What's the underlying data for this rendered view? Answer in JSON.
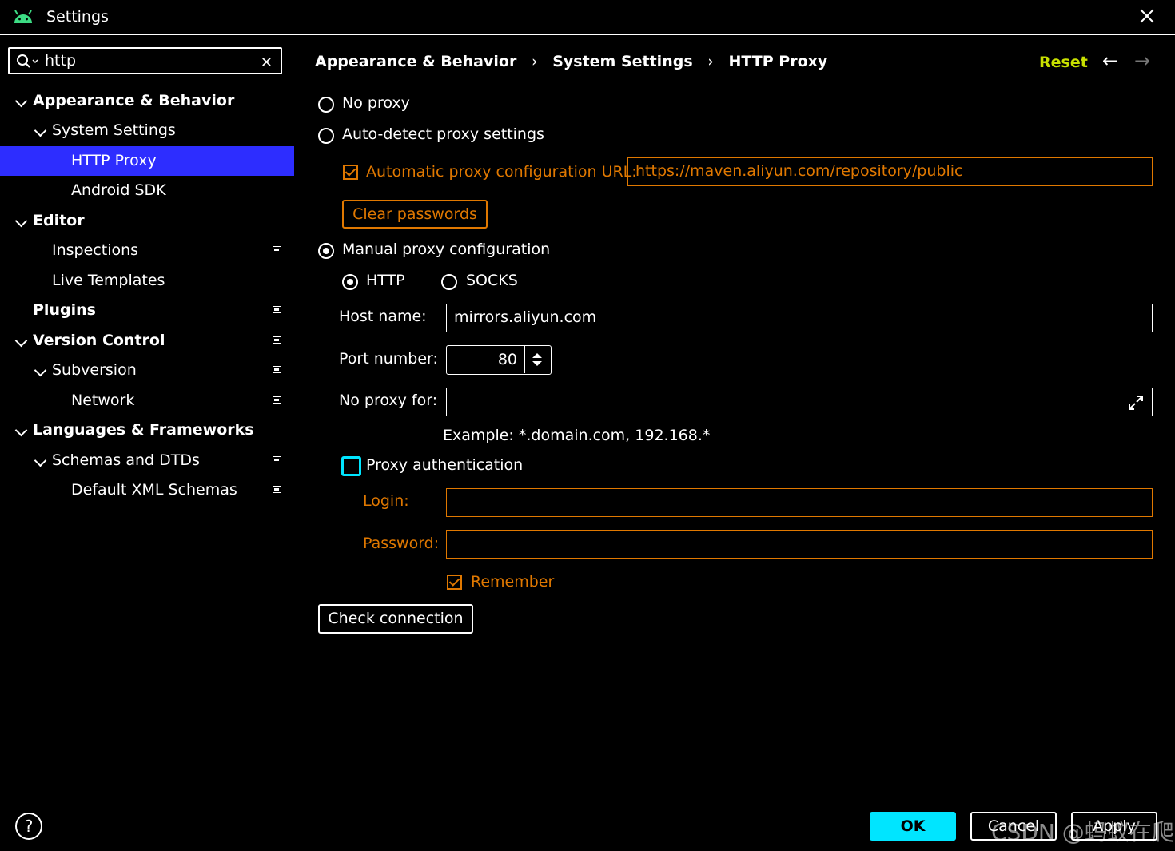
{
  "window": {
    "title": "Settings"
  },
  "search": {
    "value": "http"
  },
  "sidebar": {
    "items": [
      {
        "label": "Appearance & Behavior",
        "bold": true
      },
      {
        "label": "System Settings",
        "bold": false
      },
      {
        "label": "HTTP Proxy",
        "bold": false,
        "selected": true
      },
      {
        "label": "Android SDK",
        "bold": false
      },
      {
        "label": "Editor",
        "bold": true
      },
      {
        "label": "Inspections",
        "bold": false
      },
      {
        "label": "Live Templates",
        "bold": false
      },
      {
        "label": "Plugins",
        "bold": true
      },
      {
        "label": "Version Control",
        "bold": true
      },
      {
        "label": "Subversion",
        "bold": false
      },
      {
        "label": "Network",
        "bold": false
      },
      {
        "label": "Languages & Frameworks",
        "bold": true
      },
      {
        "label": "Schemas and DTDs",
        "bold": false
      },
      {
        "label": "Default XML Schemas",
        "bold": false
      }
    ]
  },
  "breadcrumb": {
    "items": [
      "Appearance & Behavior",
      "System Settings",
      "HTTP Proxy"
    ],
    "separator": "›"
  },
  "header": {
    "reset_label": "Reset",
    "back_icon": "←",
    "forward_icon": "→"
  },
  "proxy": {
    "no_proxy_label": "No proxy",
    "auto_detect_label": "Auto-detect proxy settings",
    "auto_url_label": "Automatic proxy configuration URL:",
    "auto_url_value": "https://maven.aliyun.com/repository/public",
    "clear_passwords_label": "Clear passwords",
    "manual_label": "Manual proxy configuration",
    "http_label": "HTTP",
    "socks_label": "SOCKS",
    "host_label": "Host name:",
    "host_value": "mirrors.aliyun.com",
    "port_label": "Port number:",
    "port_value": "80",
    "no_proxy_for_label": "No proxy for:",
    "no_proxy_for_value": "",
    "example_text": "Example: *.domain.com, 192.168.*",
    "auth_label": "Proxy authentication",
    "login_label": "Login:",
    "login_value": "",
    "password_label": "Password:",
    "password_value": "",
    "remember_label": "Remember",
    "check_connection_label": "Check connection"
  },
  "footer": {
    "help_label": "?",
    "ok_label": "OK",
    "cancel_label": "Cancel",
    "apply_label": "Apply",
    "watermark": "CSDN @蚂蚁在爬"
  },
  "colors": {
    "selected_bg": "#2d2dff",
    "accent_orange": "#e07800",
    "reset_color": "#c8e000",
    "ok_bg": "#00e5ff",
    "focus_cyan": "#00e5ff",
    "android_green": "#3ddc84"
  }
}
